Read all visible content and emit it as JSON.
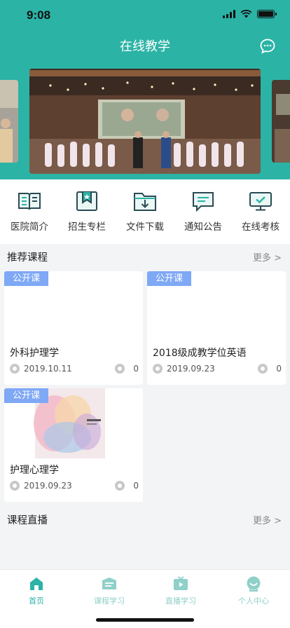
{
  "status": {
    "time": "9:08"
  },
  "nav": {
    "title": "在线教学"
  },
  "quick_links": [
    {
      "label": "医院简介",
      "icon": "book-icon"
    },
    {
      "label": "招生专栏",
      "icon": "bookmark-star-icon"
    },
    {
      "label": "文件下载",
      "icon": "folder-download-icon"
    },
    {
      "label": "通知公告",
      "icon": "message-board-icon"
    },
    {
      "label": "在线考核",
      "icon": "monitor-check-icon"
    }
  ],
  "sections": {
    "recommended": {
      "title": "推荐课程",
      "more": "更多 >"
    },
    "live": {
      "title": "课程直播",
      "more": "更多 >"
    }
  },
  "courses": [
    {
      "tag": "公开课",
      "title": "外科护理学",
      "date": "2019.10.11",
      "count": "0"
    },
    {
      "tag": "公开课",
      "title": "2018级成教学位英语",
      "date": "2019.09.23",
      "count": "0"
    },
    {
      "tag": "公开课",
      "title": "护理心理学",
      "date": "2019.09.23",
      "count": "0"
    }
  ],
  "tabs": [
    {
      "label": "首页",
      "icon": "home-icon",
      "active": true
    },
    {
      "label": "课程学习",
      "icon": "course-icon",
      "active": false
    },
    {
      "label": "直播学习",
      "icon": "live-tv-icon",
      "active": false
    },
    {
      "label": "个人中心",
      "icon": "user-icon",
      "active": false
    }
  ],
  "colors": {
    "brand": "#2bb3a6",
    "tag": "#7fa8f5",
    "tab_inactive": "#8fd0c8"
  }
}
